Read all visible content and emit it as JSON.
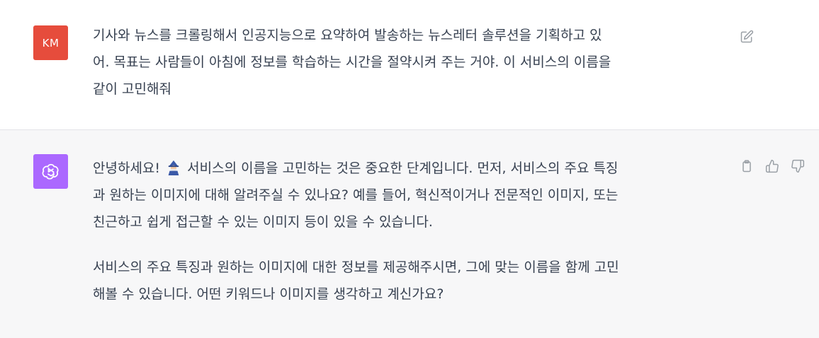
{
  "conversation": {
    "user_message": {
      "avatar_initials": "KM",
      "avatar_color": "#e64c3c",
      "lines": [
        "기사와 뉴스를 크롤링해서 인공지능으로 요약하여 발송하는 뉴스레터 솔루션을 기획하고 있",
        "어. 목표는 사람들이 아침에 정보를 학습하는 시간을 절약시켜 주는 거야. 이 서비스의 이름을",
        "같이 고민해줘"
      ]
    },
    "assistant_message": {
      "avatar_color": "#ab68ff",
      "paragraph_1": {
        "greeting": "안녕하세요!",
        "emoji": "🧙",
        "lines": [
          " 서비스의 이름을 고민하는 것은 중요한 단계입니다. 먼저, 서비스의 주요 특징",
          "과 원하는 이미지에 대해 알려주실 수 있나요? 예를 들어, 혁신적이거나 전문적인 이미지, 또는",
          "친근하고 쉽게 접근할 수 있는 이미지 등이 있을 수 있습니다."
        ]
      },
      "paragraph_2": {
        "lines": [
          "서비스의 주요 특징과 원하는 이미지에 대한 정보를 제공해주시면, 그에 맞는 이름을 함께 고민",
          "해볼 수 있습니다. 어떤 키워드나 이미지를 생각하고 계신가요?"
        ]
      }
    }
  },
  "icons": {
    "user_actions": [
      "edit-icon"
    ],
    "assistant_actions": [
      "copy-icon",
      "thumbs-up-icon",
      "thumbs-down-icon"
    ]
  }
}
